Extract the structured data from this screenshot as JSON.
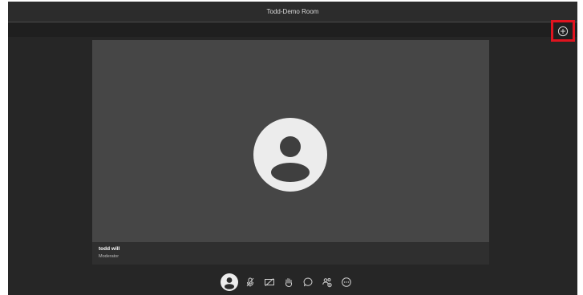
{
  "window": {
    "title": "Todd-Demo Room"
  },
  "participant": {
    "name": "todd will",
    "role": "Moderator"
  },
  "icons": {
    "add": "plus-circle-icon",
    "avatar": "user-avatar-icon",
    "controls": [
      "user-avatar-icon",
      "microphone-muted-icon",
      "camera-off-icon",
      "raise-hand-icon",
      "chat-icon",
      "participants-icon",
      "more-options-icon"
    ]
  },
  "colors": {
    "background": "#262626",
    "stage": "#464646",
    "highlight": "#e0141f",
    "avatar": "#ececec"
  }
}
